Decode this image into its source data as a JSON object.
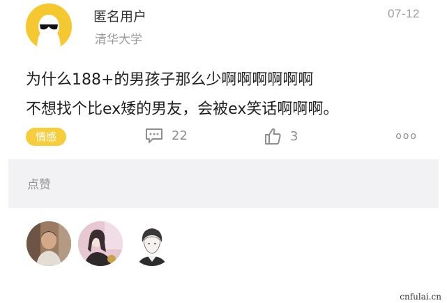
{
  "post": {
    "username": "匿名用户",
    "school": "清华大学",
    "date": "07-12",
    "body_lines": [
      "为什么188+的男孩子那么少啊啊啊啊啊啊",
      "不想找个比ex矮的男友，会被ex笑话啊啊啊。"
    ],
    "tag": "情感",
    "comment_count": "22",
    "like_count": "3",
    "more": "ooo",
    "avatar_icon": "anonymous-sunglasses-avatar"
  },
  "likes_section": {
    "label": "点赞",
    "likers": [
      {
        "icon": "user-avatar-photo"
      },
      {
        "icon": "user-avatar-photo"
      },
      {
        "icon": "user-avatar-drawing"
      }
    ]
  },
  "watermark": "cnfulai.cn",
  "colors": {
    "avatar_yellow": "#f5c730",
    "tag_yellow": "#f6cd3d",
    "panel_gray": "#f4f4f6"
  }
}
